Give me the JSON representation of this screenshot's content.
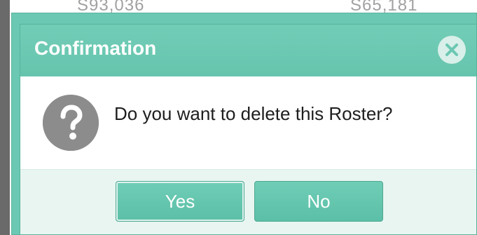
{
  "background": {
    "left_value": "S93,036",
    "right_value": "S65,181"
  },
  "dialog": {
    "title": "Confirmation",
    "close_icon": "close-circle-icon",
    "message_icon": "question-icon",
    "message": "Do you want to delete this Roster?",
    "buttons": {
      "yes_label": "Yes",
      "no_label": "No"
    }
  },
  "colors": {
    "header": "#6bc8b2",
    "button": "#62c4ac",
    "footer": "#e9f5f1",
    "icon_gray": "#8c8c8c"
  }
}
